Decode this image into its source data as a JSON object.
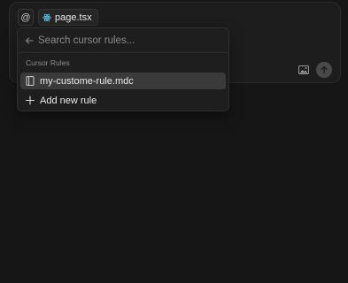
{
  "composer": {
    "at_symbol": "@",
    "file_chip_label": "page.tsx"
  },
  "dropdown": {
    "search_placeholder": "Search cursor rules...",
    "section_title": "Cursor Rules",
    "items": [
      {
        "label": "my-custome-rule.mdc",
        "icon": "document-icon",
        "selected": true
      },
      {
        "label": "Add new rule",
        "icon": "plus-icon",
        "selected": false
      }
    ]
  },
  "icons": {
    "file_chip": "react-icon",
    "image": "image-icon",
    "send": "arrow-up-icon",
    "back": "arrow-left-icon"
  },
  "colors": {
    "background": "#161616",
    "panel": "#1e1e1e",
    "selected_row": "#3a3a3a",
    "react_accent": "#61dafb"
  }
}
